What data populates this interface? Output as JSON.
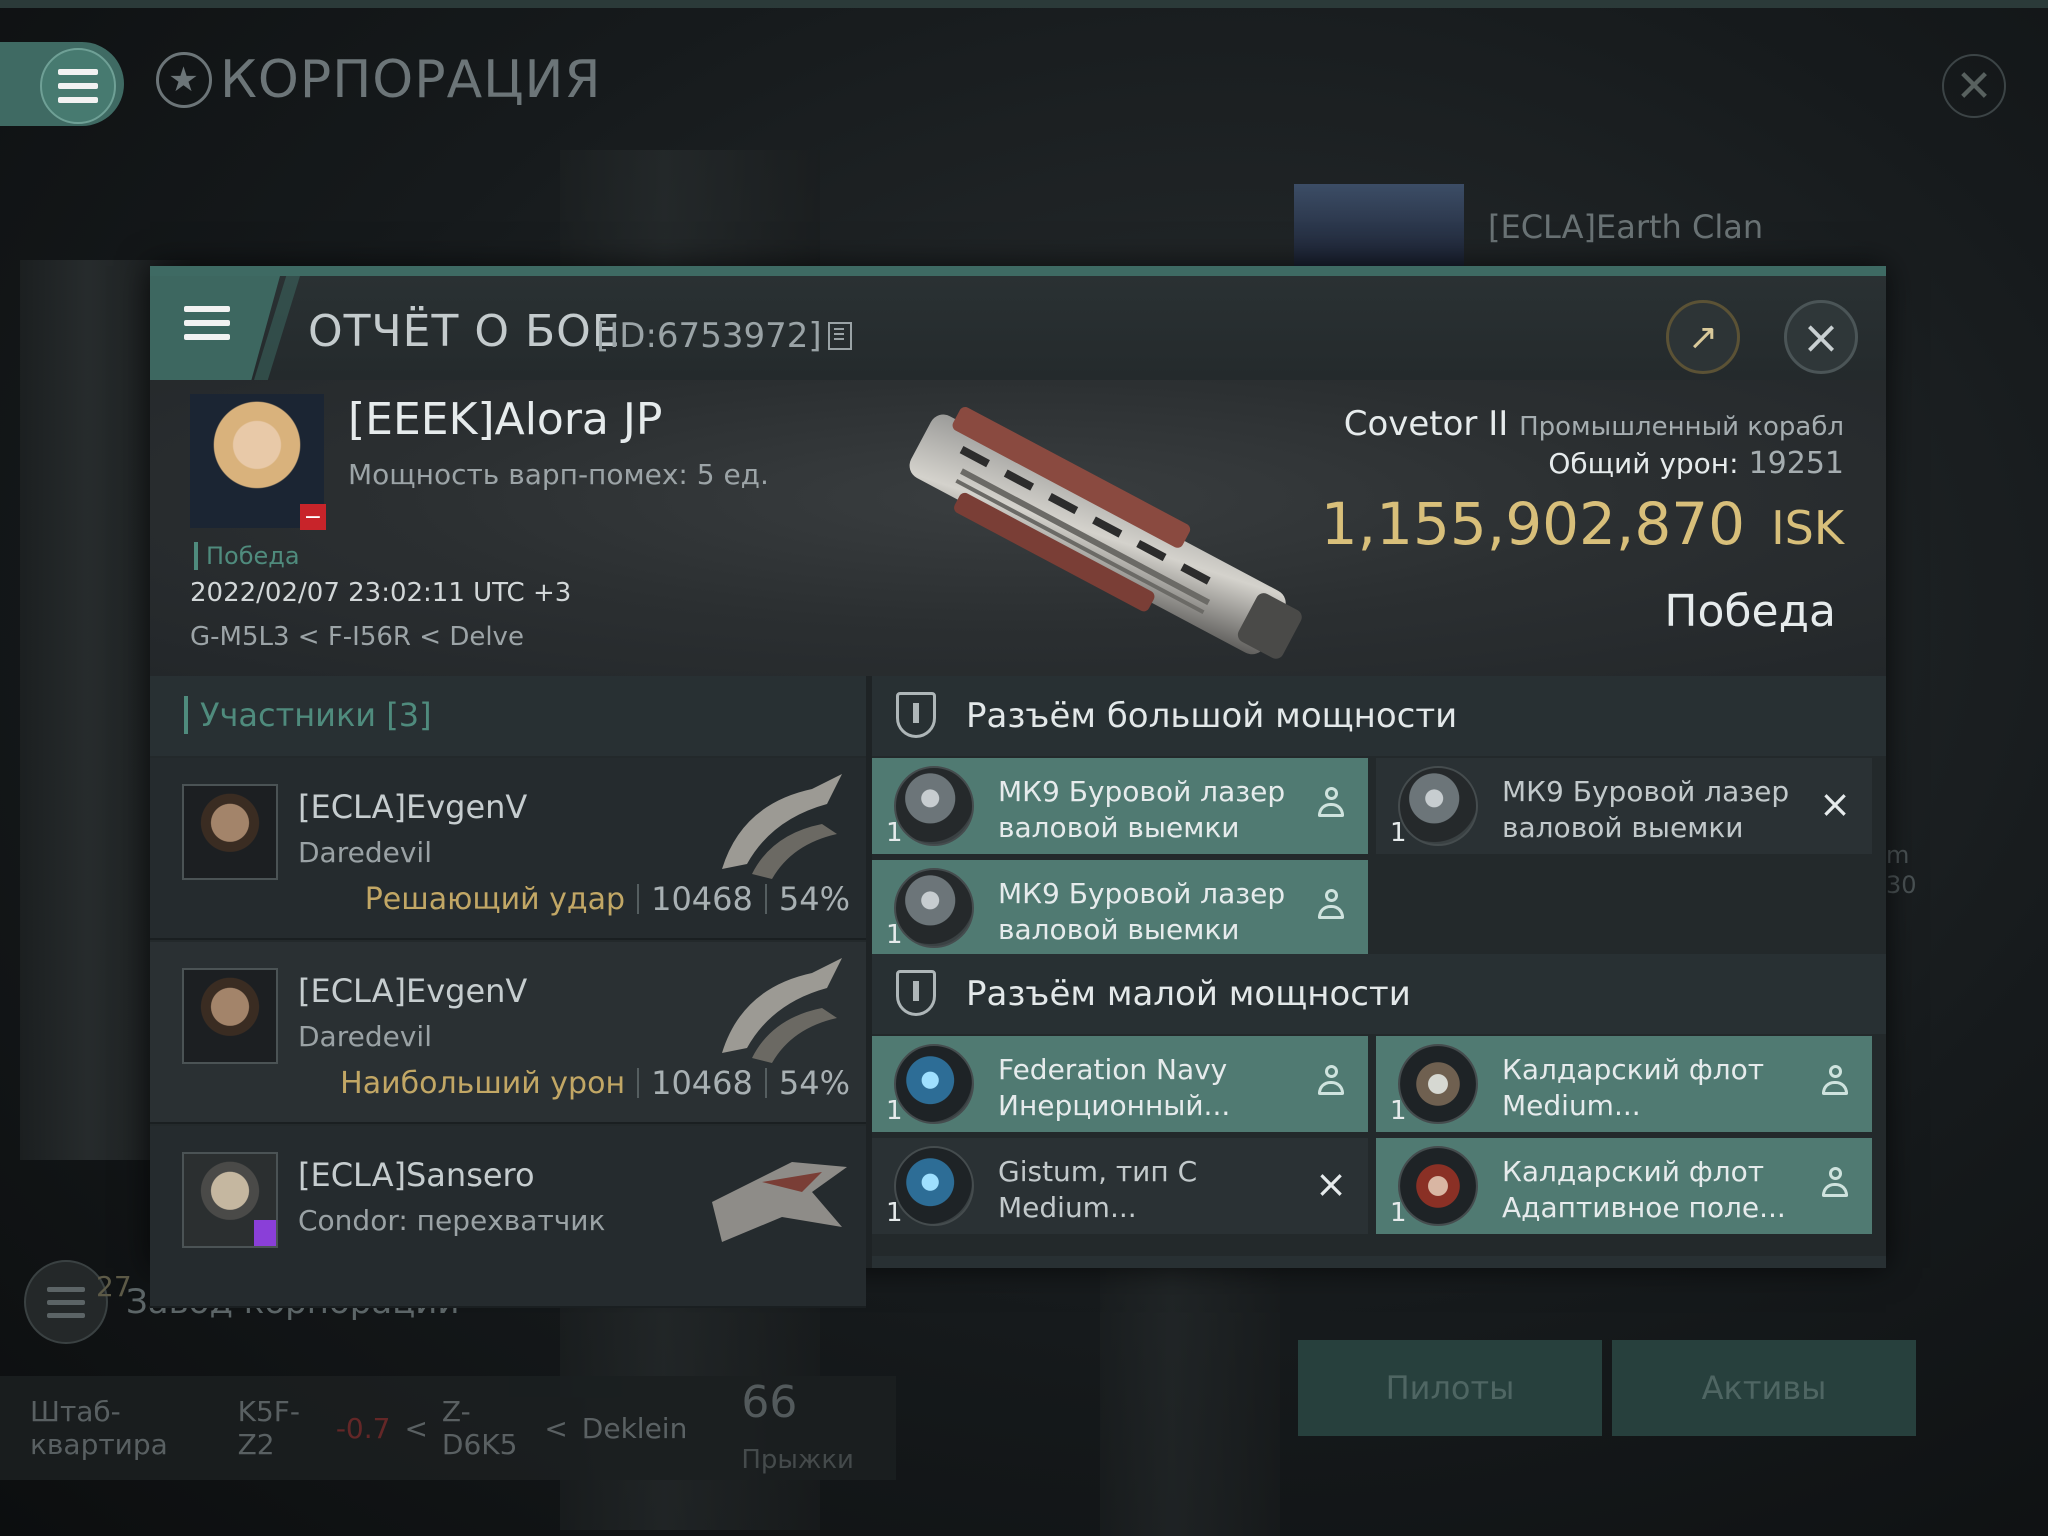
{
  "background": {
    "window_title": "КОРПОРАЦИЯ",
    "corp_name": "[ECLA]Earth Clan",
    "factory_label": "Завод корпорации",
    "factory_count": "27",
    "hq": {
      "label": "Штаб-квартира",
      "system": "K5F-Z2",
      "security": "-0.7",
      "constellation": "Z-D6K5",
      "region": "Deklein",
      "jumps_value": "66",
      "jumps_label": "Прыжки"
    },
    "buttons": {
      "pilots": "Пилоты",
      "assets": "Активы"
    },
    "side_text": [
      "m",
      "30"
    ]
  },
  "report": {
    "title": "ОТЧЁТ О БОЕ",
    "id": "[ID:6753972]",
    "victim": {
      "name": "[EEEK]Alora JP",
      "warp_disrupt": "Мощность варп-помех: 5 ед.",
      "result_tag": "Победа",
      "datetime": "2022/02/07 23:02:11 UTC +3",
      "location": "G-M5L3 < F-I56R < Delve"
    },
    "ship": {
      "name": "Covetor II",
      "type": "Промышленный корабл",
      "damage_label": "Общий урон:",
      "damage_value": "19251",
      "isk_value": "1,155,902,870",
      "isk_unit": "ISK",
      "result": "Победа"
    },
    "participants": {
      "header": "Участники [3]",
      "list": [
        {
          "name": "[ECLA]EvgenV",
          "ship": "Daredevil",
          "tag": "Решающий удар",
          "damage": "10468",
          "percent": "54%"
        },
        {
          "name": "[ECLA]EvgenV",
          "ship": "Daredevil",
          "tag": "Наибольший урон",
          "damage": "10468",
          "percent": "54%"
        },
        {
          "name": "[ECLA]Sansero",
          "ship": "Condor: перехватчик"
        }
      ]
    },
    "slots": {
      "high_title": "Разъём большой мощности",
      "low_title": "Разъём малой мощности",
      "high": [
        {
          "qty": "1",
          "name": "МК9 Буровой лазер валовой выемки",
          "status": "dropped"
        },
        {
          "qty": "1",
          "name": "МК9 Буровой лазер валовой выемки",
          "status": "destroyed"
        },
        {
          "qty": "1",
          "name": "МК9 Буровой лазер валовой выемки",
          "status": "dropped"
        }
      ],
      "low": [
        {
          "qty": "1",
          "name": "Federation Navy Инерционный...",
          "status": "dropped"
        },
        {
          "qty": "1",
          "name": "Калдарский флот Medium...",
          "status": "dropped"
        },
        {
          "qty": "1",
          "name": "Gistum, тип C Medium...",
          "status": "destroyed"
        },
        {
          "qty": "1",
          "name": "Калдарский флот Адаптивное поле...",
          "status": "dropped"
        }
      ]
    }
  }
}
